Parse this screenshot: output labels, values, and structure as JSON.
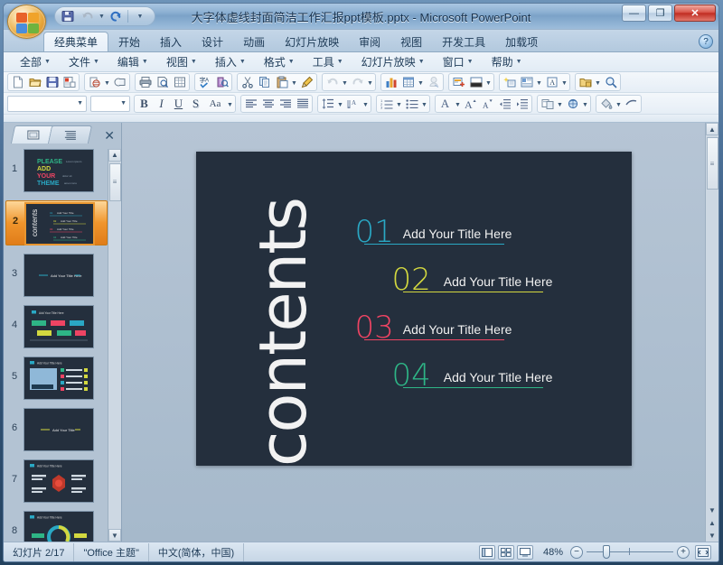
{
  "window": {
    "title": "大字体虚线封面简洁工作汇报ppt模板.pptx  -  Microsoft PowerPoint",
    "minimize_label": "—",
    "maximize_label": "❐",
    "close_label": "✕"
  },
  "quick_access": {
    "items": [
      {
        "name": "save-icon",
        "label": "保存"
      },
      {
        "name": "undo-icon",
        "label": "撤消"
      },
      {
        "name": "redo-icon",
        "label": "恢复"
      },
      {
        "name": "customize-qat-icon",
        "label": "自定义快速访问工具栏"
      }
    ]
  },
  "ribbon": {
    "tabs": [
      {
        "label": "经典菜单",
        "active": true
      },
      {
        "label": "开始",
        "active": false
      },
      {
        "label": "插入",
        "active": false
      },
      {
        "label": "设计",
        "active": false
      },
      {
        "label": "动画",
        "active": false
      },
      {
        "label": "幻灯片放映",
        "active": false
      },
      {
        "label": "审阅",
        "active": false
      },
      {
        "label": "视图",
        "active": false
      },
      {
        "label": "开发工具",
        "active": false
      },
      {
        "label": "加载项",
        "active": false
      }
    ],
    "help_label": "?"
  },
  "menubar": {
    "items": [
      {
        "label": "全部"
      },
      {
        "label": "文件"
      },
      {
        "label": "编辑"
      },
      {
        "label": "视图"
      },
      {
        "label": "插入"
      },
      {
        "label": "格式"
      },
      {
        "label": "工具"
      },
      {
        "label": "幻灯片放映"
      },
      {
        "label": "窗口"
      },
      {
        "label": "帮助"
      }
    ]
  },
  "toolbar_standard": {
    "groups": [
      {
        "items": [
          {
            "name": "new-file-icon",
            "label": "新建"
          },
          {
            "name": "open-folder-icon",
            "label": "打开"
          },
          {
            "name": "save-icon",
            "label": "保存"
          },
          {
            "name": "save-as-icon",
            "label": "另存为"
          }
        ]
      },
      {
        "items": [
          {
            "name": "email-icon",
            "label": "电子邮件",
            "dropdown": true
          },
          {
            "name": "attachment-icon",
            "label": "附件"
          }
        ]
      },
      {
        "items": [
          {
            "name": "print-icon",
            "label": "打印"
          },
          {
            "name": "print-preview-icon",
            "label": "打印预览"
          },
          {
            "name": "table-icon",
            "label": "表格"
          }
        ]
      },
      {
        "items": [
          {
            "name": "spellcheck-icon",
            "label": "拼写检查"
          },
          {
            "name": "research-icon",
            "label": "信息检索"
          }
        ]
      },
      {
        "items": [
          {
            "name": "cut-icon",
            "label": "剪切"
          },
          {
            "name": "copy-icon",
            "label": "复制"
          },
          {
            "name": "paste-icon",
            "label": "粘贴",
            "dropdown": true
          },
          {
            "name": "format-painter-icon",
            "label": "格式刷"
          }
        ]
      },
      {
        "items": [
          {
            "name": "undo-icon",
            "label": "撤消",
            "dropdown": true
          },
          {
            "name": "redo-icon",
            "label": "恢复",
            "dropdown": true
          }
        ]
      },
      {
        "items": [
          {
            "name": "chart-icon",
            "label": "图表"
          },
          {
            "name": "insert-table-icon",
            "label": "插入表格",
            "dropdown": true
          },
          {
            "name": "hyperlink-icon",
            "label": "超链接"
          }
        ]
      },
      {
        "items": [
          {
            "name": "new-slide-icon",
            "label": "新建幻灯片"
          },
          {
            "name": "slide-design-icon",
            "label": "幻灯片设计",
            "dropdown": true
          }
        ]
      },
      {
        "items": [
          {
            "name": "animation-icon",
            "label": "动画方案"
          },
          {
            "name": "slide-layout-icon",
            "label": "幻灯片版式",
            "dropdown": true
          },
          {
            "name": "text-style-icon",
            "label": "文本样式",
            "dropdown": true
          }
        ]
      },
      {
        "items": [
          {
            "name": "shapes-icon",
            "label": "形状",
            "dropdown": true
          },
          {
            "name": "zoom-icon",
            "label": "显示比例"
          }
        ]
      }
    ]
  },
  "toolbar_format": {
    "font_name": "",
    "font_size": "",
    "groups": [
      {
        "items": [
          {
            "name": "bold-icon",
            "label": "B"
          },
          {
            "name": "italic-icon",
            "label": "I"
          },
          {
            "name": "underline-icon",
            "label": "U"
          },
          {
            "name": "shadow-icon",
            "label": "S"
          },
          {
            "name": "change-case-icon",
            "label": "Aa",
            "dropdown": true
          }
        ]
      },
      {
        "items": [
          {
            "name": "align-left-icon",
            "label": "左对齐"
          },
          {
            "name": "align-center-icon",
            "label": "居中"
          },
          {
            "name": "align-right-icon",
            "label": "右对齐"
          },
          {
            "name": "justify-icon",
            "label": "两端对齐"
          }
        ]
      },
      {
        "items": [
          {
            "name": "line-spacing-icon",
            "label": "行距",
            "dropdown": true
          },
          {
            "name": "character-spacing-icon",
            "label": "字符间距",
            "dropdown": true
          }
        ]
      },
      {
        "items": [
          {
            "name": "numbered-list-icon",
            "label": "编号",
            "dropdown": true
          },
          {
            "name": "bulleted-list-icon",
            "label": "项目符号",
            "dropdown": true
          }
        ]
      },
      {
        "items": [
          {
            "name": "font-color-icon",
            "label": "字体颜色",
            "dropdown": true
          },
          {
            "name": "increase-font-icon",
            "label": "增大字号"
          },
          {
            "name": "decrease-font-icon",
            "label": "减小字号"
          },
          {
            "name": "decrease-indent-icon",
            "label": "减少缩进"
          },
          {
            "name": "increase-indent-icon",
            "label": "增加缩进"
          }
        ]
      },
      {
        "items": [
          {
            "name": "slide-transition-icon",
            "label": "幻灯片切换",
            "dropdown": true
          },
          {
            "name": "custom-animation-icon",
            "label": "自定义动画",
            "dropdown": true
          }
        ]
      },
      {
        "items": [
          {
            "name": "fill-color-icon",
            "label": "填充颜色",
            "dropdown": true
          },
          {
            "name": "line-color-icon",
            "label": "线条颜色"
          }
        ]
      }
    ]
  },
  "slide_panel": {
    "tabs": [
      {
        "name": "slides-tab",
        "label": "幻灯片",
        "active": true
      },
      {
        "name": "outline-tab",
        "label": "大纲",
        "active": false
      }
    ],
    "close_label": "✕",
    "thumbnails": [
      {
        "number": "1",
        "kind": "title",
        "selected": false
      },
      {
        "number": "2",
        "kind": "contents",
        "selected": true
      },
      {
        "number": "3",
        "kind": "section",
        "selected": false
      },
      {
        "number": "4",
        "kind": "timeline",
        "selected": false
      },
      {
        "number": "5",
        "kind": "photo-list",
        "selected": false
      },
      {
        "number": "6",
        "kind": "section",
        "selected": false
      },
      {
        "number": "7",
        "kind": "hex-diagram",
        "selected": false
      },
      {
        "number": "8",
        "kind": "donut-chart",
        "selected": false
      }
    ],
    "scroll_up_label": "▲",
    "scroll_down_label": "▼"
  },
  "slide": {
    "background_color": "#242f3d",
    "heading": "contents",
    "items": [
      {
        "number": "01",
        "title": "Add Your Title Here",
        "color": "#2aa8c4"
      },
      {
        "number": "02",
        "title": "Add Your Title Here",
        "color": "#d3d83f"
      },
      {
        "number": "03",
        "title": "Add Your Title Here",
        "color": "#ef4463"
      },
      {
        "number": "04",
        "title": "Add Your Title Here",
        "color": "#2eb586"
      }
    ]
  },
  "stage_scrollbar": {
    "up_label": "▲",
    "down_label": "▼",
    "prev_slide_label": "▲",
    "next_slide_label": "▼",
    "back_label": "▼"
  },
  "statusbar": {
    "slide_counter": "幻灯片 2/17",
    "theme": "\"Office 主题\"",
    "language": "中文(简体，中国)",
    "views": [
      {
        "name": "normal-view-button",
        "label": "普通视图"
      },
      {
        "name": "slide-sorter-button",
        "label": "幻灯片浏览"
      },
      {
        "name": "slideshow-button",
        "label": "幻灯片放映"
      }
    ],
    "zoom_percent": "48%",
    "zoom_out_label": "−",
    "zoom_in_label": "+",
    "fit_label": "适应窗口"
  }
}
